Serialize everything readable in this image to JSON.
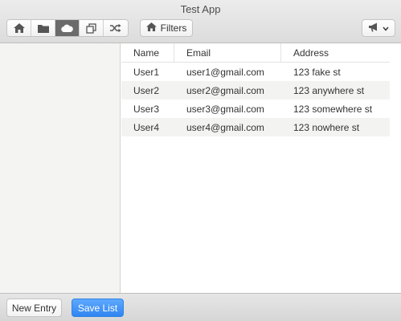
{
  "window": {
    "title": "Test App"
  },
  "toolbar": {
    "segments": [
      {
        "icon": "home-icon",
        "active": false
      },
      {
        "icon": "folder-icon",
        "active": false
      },
      {
        "icon": "cloud-icon",
        "active": true
      },
      {
        "icon": "copy-icon",
        "active": false
      },
      {
        "icon": "shuffle-icon",
        "active": false
      }
    ],
    "filters_button": {
      "icon": "home-icon",
      "label": "Filters"
    },
    "menu_button": {
      "icon": "megaphone-icon",
      "chevron": "chevron-down-icon"
    }
  },
  "table": {
    "columns": [
      "Name",
      "Email",
      "Address"
    ],
    "rows": [
      [
        "User1",
        "user1@gmail.com",
        "123 fake st"
      ],
      [
        "User2",
        "user2@gmail.com",
        "123 anywhere st"
      ],
      [
        "User3",
        "user3@gmail.com",
        "123 somewhere st"
      ],
      [
        "User4",
        "user4@gmail.com",
        "123 nowhere st"
      ]
    ]
  },
  "footer": {
    "new_entry_label": "New Entry",
    "save_list_label": "Save List"
  },
  "colors": {
    "accent": "#2f86f0",
    "active_segment": "#6b6b6b",
    "sidebar": "#f4f4f2",
    "alt_row": "#f3f3f1"
  }
}
